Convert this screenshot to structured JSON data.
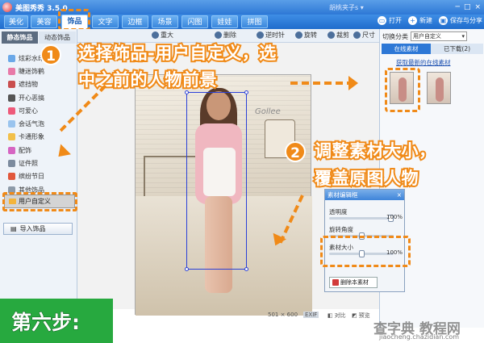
{
  "window": {
    "title": "美图秀秀 3.5.0",
    "user": "胡桃夹子s ▾",
    "controls": [
      "─",
      "□",
      "×"
    ]
  },
  "nav": {
    "tabs": [
      "美化",
      "美容",
      "饰品",
      "文字",
      "边框",
      "场景",
      "闪图",
      "娃娃",
      "拼图"
    ],
    "active": "饰品",
    "right": [
      {
        "icon": "open-icon",
        "label": "打开"
      },
      {
        "icon": "new-icon",
        "label": "新建"
      },
      {
        "icon": "save-icon",
        "label": "保存与分享"
      }
    ]
  },
  "sidebar": {
    "tabs": [
      "静态饰品",
      "动态饰品"
    ],
    "items": [
      "炫彩水印",
      "睫迷饰鹤",
      "遮挡物",
      "开心恶搞",
      "可爱心",
      "会话气泡",
      "卡通形象",
      "配饰",
      "证件照",
      "缤纷节日",
      "其他饰品"
    ],
    "selected": "用户自定义",
    "import_button": "导入饰品"
  },
  "canvas_toolbar": [
    "重大",
    "删除",
    "逆时针",
    "旋转",
    "裁剪",
    "尺寸"
  ],
  "status": {
    "size": "501 × 600",
    "compare": "对比",
    "preview": "预览"
  },
  "right_panel": {
    "category_label": "切换分类",
    "category_value": "用户自定义",
    "tabs": [
      "在线素材",
      "已下载(2)"
    ],
    "link": "获取最新的在线素材"
  },
  "dialog": {
    "title": "素材编辑框",
    "close": "×",
    "opacity_label": "透明度",
    "opacity_value": "100%",
    "rotate_label": "旋转角度",
    "size_label": "素材大小",
    "size_value": "100%",
    "delete_button": "删除本素材"
  },
  "annotations": {
    "step1_num": "1",
    "step1_line1": "选择饰品-用户自定义，选",
    "step1_line2": "中之前的人物前景",
    "step2_num": "2",
    "step2_line1": "调整素材大小，",
    "step2_line2": "覆盖原图人物",
    "step_title": "第六步:"
  },
  "watermark": {
    "main": "查字典 教程网",
    "url": "jiaocheng.chazidian.com",
    "photo": "Gollee"
  },
  "colors": {
    "accent": "#f08a18",
    "nav_blue": "#2d78d6",
    "step_green": "#27a93f"
  }
}
